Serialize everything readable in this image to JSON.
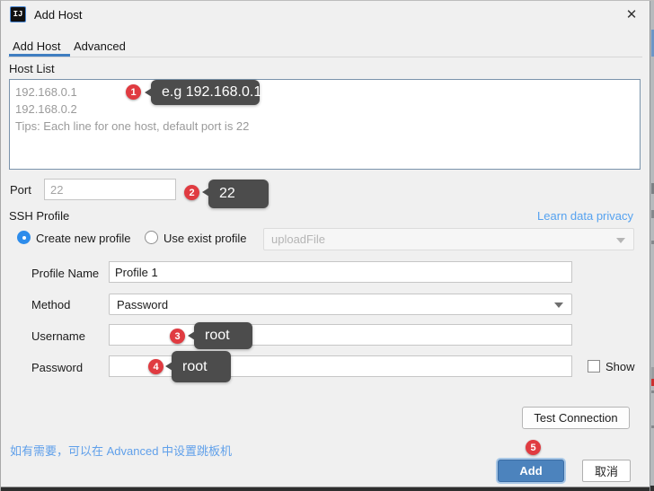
{
  "window": {
    "title": "Add Host",
    "close_glyph": "✕",
    "app_icon_text": "IJ"
  },
  "tabs": {
    "add_host": "Add Host",
    "advanced": "Advanced"
  },
  "host_list": {
    "label": "Host List",
    "placeholder_lines": {
      "line1": "192.168.0.1",
      "line2": "192.168.0.2",
      "line3": "Tips: Each line for one host, default port is 22"
    }
  },
  "port": {
    "label": "Port",
    "placeholder": "22"
  },
  "ssh_profile": {
    "label": "SSH Profile",
    "privacy_link": "Learn data privacy",
    "radio_new_label": "Create new profile",
    "radio_exist_label": "Use exist profile",
    "exist_profile_value": "uploadFile"
  },
  "fields": {
    "profile_name": {
      "label": "Profile Name",
      "value": "Profile 1"
    },
    "method": {
      "label": "Method",
      "value": "Password"
    },
    "username": {
      "label": "Username",
      "value": ""
    },
    "password": {
      "label": "Password",
      "value": "",
      "show_label": "Show"
    }
  },
  "buttons": {
    "test_connection": "Test Connection",
    "add": "Add",
    "cancel": "取消"
  },
  "footer_note": "如有需要，可以在 Advanced 中设置跳板机",
  "annotations": {
    "a1": {
      "num": "1",
      "tooltip": "e.g 192.168.0.1"
    },
    "a2": {
      "num": "2",
      "tooltip": "22"
    },
    "a3": {
      "num": "3",
      "tooltip": "root"
    },
    "a4": {
      "num": "4",
      "tooltip": "root"
    },
    "a5": {
      "num": "5",
      "tooltip": ""
    }
  },
  "colors": {
    "accent_blue": "#3f7ec1",
    "button_blue": "#4c83bd",
    "radio_blue": "#2d8ceb",
    "link_blue": "#55a2f0",
    "annotation_red": "#e03b41",
    "tooltip_gray": "#4c4c4c"
  }
}
